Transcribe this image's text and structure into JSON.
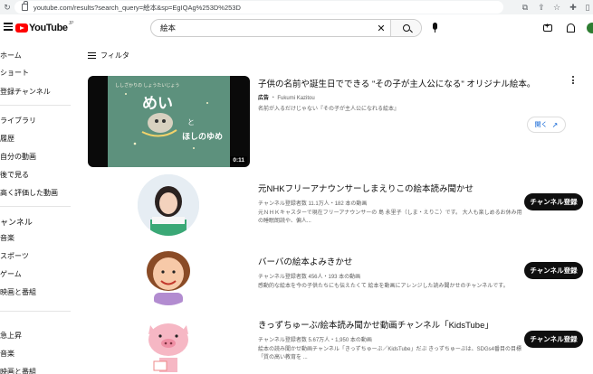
{
  "browser": {
    "url": "youtube.com/results?search_query=絵本&sp=EgIQAg%253D%253D"
  },
  "header": {
    "logo_text": "YouTube",
    "logo_suffix": "JP",
    "search_value": "絵本"
  },
  "sidebar": {
    "items": [
      {
        "label": "ホーム"
      },
      {
        "label": "ショート"
      },
      {
        "label": "登録チャンネル"
      },
      {
        "label": "ライブラリ"
      },
      {
        "label": "履歴"
      },
      {
        "label": "自分の動画"
      },
      {
        "label": "後で見る"
      },
      {
        "label": "高く評価した動画"
      }
    ],
    "section_label": "ャンネル",
    "channel_items": [
      {
        "label": "音楽"
      },
      {
        "label": "スポーツ"
      },
      {
        "label": "ゲーム"
      },
      {
        "label": "映画と番組"
      }
    ],
    "explore_items": [
      {
        "label": "急上昇"
      },
      {
        "label": "音楽"
      },
      {
        "label": "映画と番組"
      }
    ]
  },
  "filter": {
    "label": "フィルタ"
  },
  "ad": {
    "title": "子供の名前や誕生日でできる \"その子が主人公になる\" オリジナル絵本。",
    "badge": "広告",
    "advertiser": "Fukumi Kazitou",
    "description": "名前が入るだけじゃない『その子が主人公になれる絵本』",
    "duration": "0:11",
    "button_label": "開く",
    "thumb_text_top": "ししざかりの しょうたいじょう",
    "thumb_text_main": "めい",
    "thumb_text_sub": "と",
    "thumb_text_bottom": "ほしのゆめ"
  },
  "results": [
    {
      "title": "元NHKフリーアナウンサーしまえりこの絵本読み聞かせ",
      "meta": "チャンネル登録者数 11.1万人・182 本の動画",
      "description": "元ＮＨＫキャスターで現在フリーアナウンサーの 島 永里子（しま・えりこ）です。 大人も楽しめるお休み用の睡眠朗読や、偏人...",
      "subscribe": "チャンネル登録"
    },
    {
      "title": "バーバの絵本よみきかせ",
      "meta": "チャンネル登録者数 456人・193 本の動画",
      "description": "感動的な絵本を今の子供たちにも伝えたくて 絵本を動画にアレンジした読み聞かせのチャンネルです。",
      "subscribe": "チャンネル登録"
    },
    {
      "title": "きっずちゅーぶ/絵本読み聞かせ動画チャンネル「KidsTube」",
      "meta": "チャンネル登録者数 5.67万人・1,950 本の動画",
      "description": "絵本の読み聞かせ動画チャンネル「きっずちゅーぶ／KidsTube」だぶ きっずちゅーぶは、SDGs4番目の目標「質の高い教育を ...",
      "subscribe": "チャンネル登録"
    }
  ],
  "colors": {
    "brand_red": "#ff0000",
    "link_blue": "#065fd4",
    "text_secondary": "#606060"
  }
}
